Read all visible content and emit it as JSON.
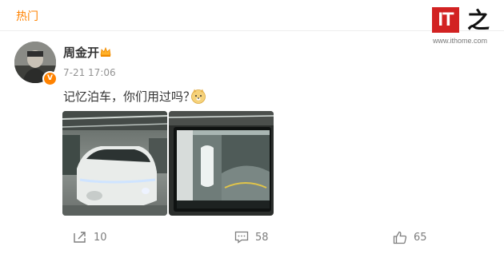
{
  "header": {
    "tab_hot": "热门"
  },
  "watermark": {
    "logo_text": "IT",
    "logo_char": "之家",
    "url": "www.ithome.com"
  },
  "post": {
    "author": "周金开",
    "time": "7-21 17:06",
    "text": "记忆泊车，你们用过吗？",
    "verified_badge": "V",
    "images": [
      {
        "name": "white-car-in-parking-garage"
      },
      {
        "name": "car-screen-parking-view"
      }
    ]
  },
  "actions": {
    "repost_count": "10",
    "comment_count": "58",
    "like_count": "65"
  },
  "colors": {
    "accent": "#ff8200",
    "text": "#333333",
    "muted": "#939393",
    "brand_red": "#d22222"
  }
}
